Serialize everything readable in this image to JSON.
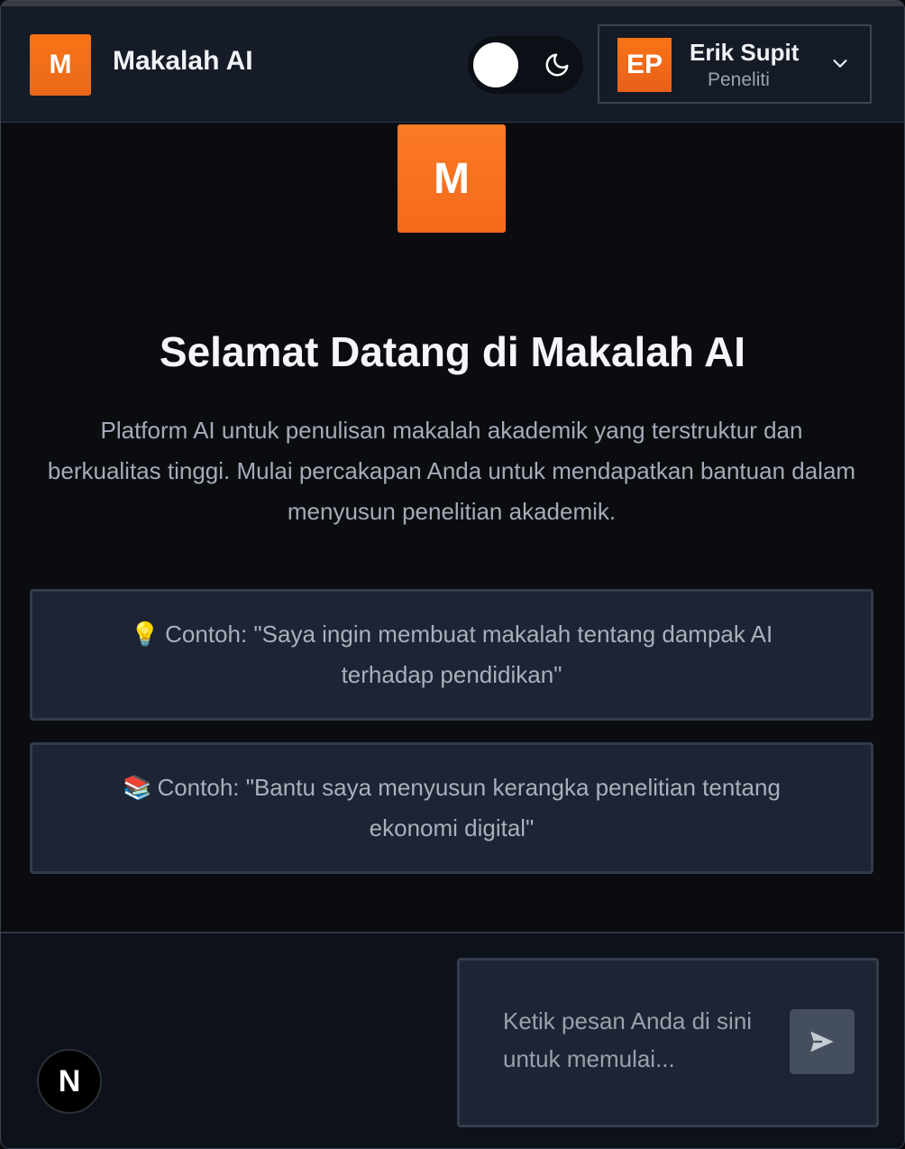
{
  "header": {
    "logo_letter": "M",
    "app_title": "Makalah AI",
    "theme_toggle_icon": "moon-icon",
    "user": {
      "initials": "EP",
      "name": "Erik Supit",
      "role": "Peneliti",
      "menu_icon": "chevron-down-icon"
    }
  },
  "welcome": {
    "logo_letter": "M",
    "title": "Selamat Datang di Makalah AI",
    "description": "Platform AI untuk penulisan makalah akademik yang terstruktur dan berkualitas tinggi. Mulai percakapan Anda untuk mendapatkan bantuan dalam menyusun penelitian akademik.",
    "examples": [
      {
        "emoji": "💡",
        "text": "Contoh: \"Saya ingin membuat makalah tentang dampak AI terhadap pendidikan\""
      },
      {
        "emoji": "📚",
        "text": "Contoh: \"Bantu saya menyusun kerangka penelitian tentang ekonomi digital\""
      }
    ]
  },
  "composer": {
    "placeholder": "Ketik pesan Anda di sini untuk memulai...",
    "value": "",
    "send_icon": "send-icon"
  },
  "badge": {
    "letter": "N"
  },
  "colors": {
    "accent": "#f97316",
    "background": "#0a0c10",
    "header_bg": "#151c28",
    "card_bg": "#1d2433"
  }
}
